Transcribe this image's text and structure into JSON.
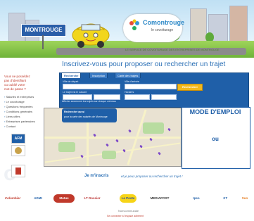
{
  "header": {
    "sign_text": "MONTROUGE",
    "logo_text": "Comontrouge",
    "logo_sub": "le covoiturage",
    "tagline": "LE SERVICE DE COVOITURAGE DES ENTREPRISES DE MONTROUGE"
  },
  "headline": "Inscrivez-vous pour proposer ou rechercher un trajet",
  "sidebar": {
    "top_text": [
      "Vous ne possédez",
      "pas d'identifiant",
      "ou oublié votre",
      "mot de passe ?"
    ],
    "menu": [
      "Salariés et entreprises",
      "Le covoiturage",
      "Questions fréquentes",
      "Conditions générales",
      "Liens utiles",
      "Entreprises partenaires",
      "Contact"
    ],
    "badges": [
      "AFM",
      "",
      ""
    ]
  },
  "form": {
    "tabs": [
      "Recherche",
      "Inscription",
      "Carte des trajets"
    ],
    "label_from": "Ville de départ",
    "label_to": "Ville d'arrivée",
    "label_date": "Le trajet est le suivant",
    "label_time": "Horaires",
    "placeholder_from": "",
    "placeholder_to": "",
    "search_button": "Rechercher",
    "options": "Afficher seulement les trajets sur chaque créneau"
  },
  "map": {
    "bubble_line1": "Rechercher aussi",
    "bubble_line2": "pour la carte des salariés de Montrouge"
  },
  "panel": {
    "title": "MODE D'EMPLOI",
    "ou": "ou"
  },
  "cta": {
    "strong": "Je m'inscris",
    "rest": "et je peux proposer ou rechercher un trajet !"
  },
  "partners": [
    "Colombier",
    "ADMI",
    "Motus",
    "LT Dossier",
    "La Poste",
    "MEDIAPOST",
    "Ipso",
    "ST",
    "Sun"
  ],
  "footer": {
    "logo": "Nomcommunale",
    "link": "Se connecter à l'espace adhérent"
  },
  "colors": {
    "brand_blue": "#1f5fa8",
    "accent_yellow": "#f3b81a",
    "grass": "#6fb33a"
  }
}
